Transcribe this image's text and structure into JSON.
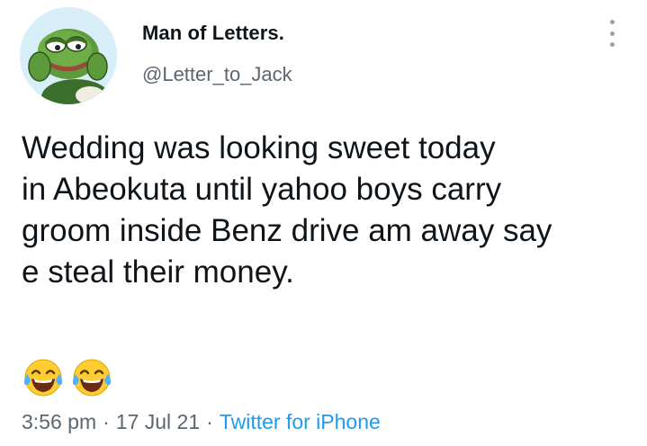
{
  "author": {
    "display_name": "Man of Letters.",
    "handle": "@Letter_to_Jack",
    "avatar_icon": "pepe-frog-avatar"
  },
  "tweet": {
    "text": "Wedding was looking sweet today\nin Abeokuta until yahoo boys carry\ngroom inside Benz drive am away say\ne steal their money.",
    "emojis": [
      "tears-of-joy-emoji",
      "tears-of-joy-emoji"
    ]
  },
  "meta": {
    "time": "3:56 pm",
    "separator": "·",
    "date": "17 Jul 21",
    "source": "Twitter for iPhone"
  },
  "colors": {
    "text": "#0f1419",
    "secondary": "#5b6670",
    "link": "#1d9bf0",
    "background": "#ffffff"
  },
  "icons": {
    "more_menu": "more-vertical-icon"
  }
}
